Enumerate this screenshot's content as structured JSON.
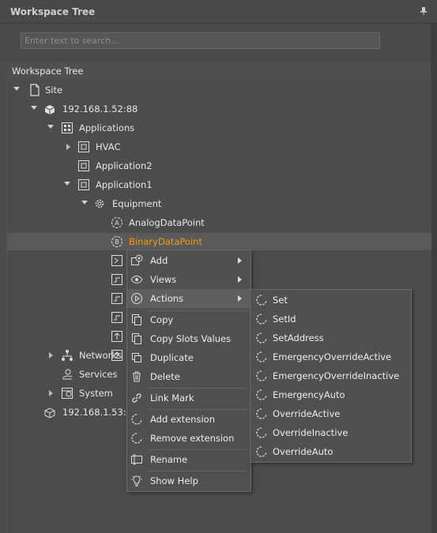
{
  "panel": {
    "title": "Workspace Tree"
  },
  "search": {
    "placeholder": "Enter text to search..."
  },
  "tree": {
    "header": "Workspace Tree",
    "nodes": {
      "site": "Site",
      "device1": "192.168.1.52:88",
      "applications": "Applications",
      "hvac": "HVAC",
      "application2": "Application2",
      "application1": "Application1",
      "equipment": "Equipment",
      "analog": "AnalogDataPoint",
      "binary": "BinaryDataPoint",
      "networks": "Networks",
      "services": "Services",
      "system": "System",
      "device2": "192.168.1.53:1"
    }
  },
  "context_menu": {
    "items": [
      {
        "label": "Add",
        "icon": "add-icon",
        "has_submenu": true
      },
      {
        "label": "Views",
        "icon": "eye-icon",
        "has_submenu": true
      },
      {
        "label": "Actions",
        "icon": "play-icon",
        "has_submenu": true
      },
      {
        "label": "Copy",
        "icon": "copy-icon"
      },
      {
        "label": "Copy Slots Values",
        "icon": "copy-slots-icon"
      },
      {
        "label": "Duplicate",
        "icon": "duplicate-icon"
      },
      {
        "label": "Delete",
        "icon": "trash-icon"
      },
      {
        "label": "Link Mark",
        "icon": "link-icon"
      },
      {
        "label": "Add extension",
        "icon": "spinner-icon"
      },
      {
        "label": "Remove extension",
        "icon": "spinner-icon"
      },
      {
        "label": "Rename",
        "icon": "rename-icon"
      },
      {
        "label": "Show Help",
        "icon": "lightbulb-icon"
      }
    ]
  },
  "actions_submenu": {
    "items": [
      "Set",
      "SetId",
      "SetAddress",
      "EmergencyOverrideActive",
      "EmergencyOverrideInactive",
      "EmergencyAuto",
      "OverrideActive",
      "OverrideInactive",
      "OverrideAuto"
    ]
  },
  "colors": {
    "selected_text": "#f0a000",
    "background": "#4c4c4c",
    "menu_bg": "#505050"
  }
}
